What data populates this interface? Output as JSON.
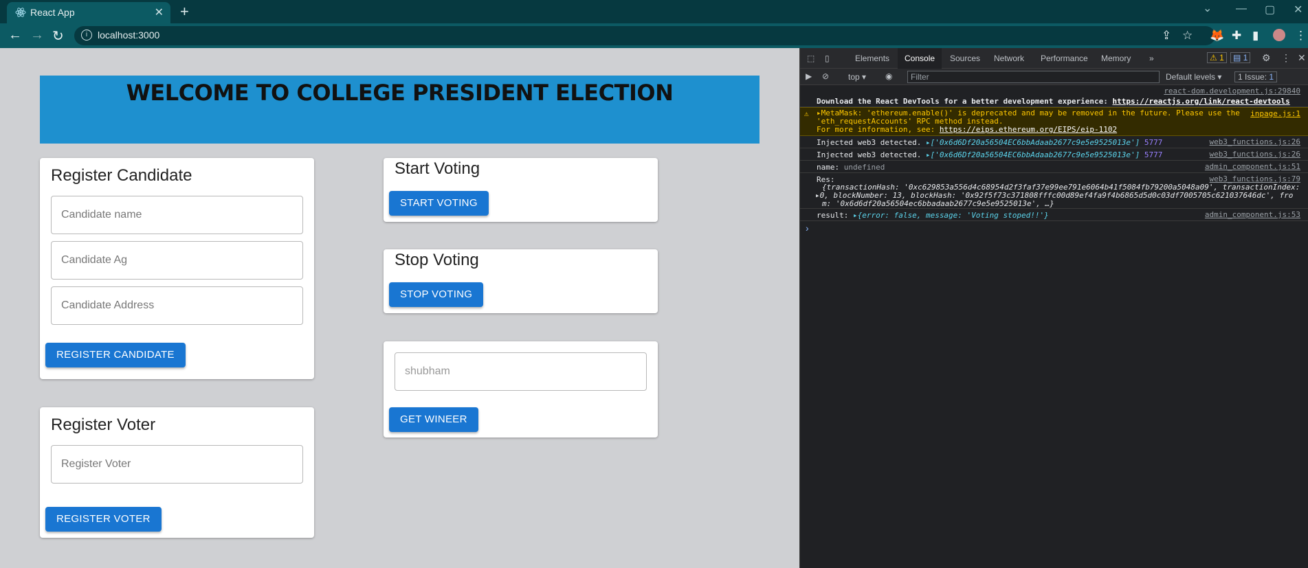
{
  "browser": {
    "tab_title": "React App",
    "tab_close": "✕",
    "new_tab": "+",
    "url": "localhost:3000",
    "win_min": "—",
    "win_max": "▢",
    "win_close": "✕"
  },
  "page": {
    "banner_title": "WELCOME TO COLLEGE PRESIDENT ELECTION",
    "register_candidate": {
      "title": "Register Candidate",
      "name_placeholder": "Candidate name",
      "age_placeholder": "Candidate Ag",
      "address_placeholder": "Candidate Address",
      "button": "REGISTER CANDIDATE"
    },
    "register_voter": {
      "title": "Register Voter",
      "placeholder": "Register Voter",
      "button": "REGISTER VOTER"
    },
    "start_voting": {
      "title": "Start Voting",
      "button": "START VOTING"
    },
    "stop_voting": {
      "title": "Stop Voting",
      "button": "STOP VOTING"
    },
    "winner": {
      "input_value": "shubham",
      "button": "GET WINEER"
    }
  },
  "devtools": {
    "tabs": [
      "Elements",
      "Console",
      "Sources",
      "Network",
      "Performance",
      "Memory"
    ],
    "active_tab": "Console",
    "more": "»",
    "warn_count": "1",
    "msg_count": "1",
    "context": "top",
    "filter_placeholder": "Filter",
    "levels": "Default levels",
    "issues": "1 Issue:",
    "issues_count": "1",
    "console": {
      "l1_src": "react-dom.development.js:29840",
      "l1_text": "Download the React DevTools for a better development experience:",
      "l1_link": "https://reactjs.org/link/react-devtools",
      "l2_src": "inpage.js:1",
      "l2_a": "▸MetaMask: 'ethereum.enable()' is deprecated and may be removed in the future. Please use the",
      "l2_b": "'eth_requestAccounts' RPC method instead.",
      "l2_c": "For more information, see:",
      "l2_link": "https://eips.ethereum.org/EIPS/eip-1102",
      "l3_text": "Injected web3 detected.",
      "l3_arr": "▸['0x6d6Df20a56504EC6bbAdaab2677c9e5e9525013e']",
      "l3_num": "5777",
      "l3_src": "web3_functions.js:26",
      "l4_text": "Injected web3 detected.",
      "l4_arr": "▸['0x6d6Df20a56504EC6bbAdaab2677c9e5e9525013e']",
      "l4_num": "5777",
      "l4_src": "web3_functions.js:26",
      "l5_text": "name:",
      "l5_val": "undefined",
      "l5_src": "admin_component.js:51",
      "l6_text": "Res:",
      "l6_src": "web3_functions.js:79",
      "l6_a": "{transactionHash: '0xc629853a556d4c68954d2f3faf37e99ee791e6064b41f5084fb79200a5048a09', transactionIndex:",
      "l6_b": "▸0, blockNumber: 13, blockHash: '0x92f5f73c371808fffc00d89ef4fa9f4b6865d5d0c03df7005705c621037646dc', fro",
      "l6_c": "m: '0x6d6df20a56504ec6bbadaab2677c9e5e9525013e', …}",
      "l7_text": "result:",
      "l7_val": "▸{error: false, message: 'Voting stoped!!'}",
      "l7_src": "admin_component.js:53",
      "prompt": "›"
    }
  },
  "colors": {
    "banner": "#1e90cf",
    "button": "#1976d2",
    "chrome": "#0c5a63"
  }
}
